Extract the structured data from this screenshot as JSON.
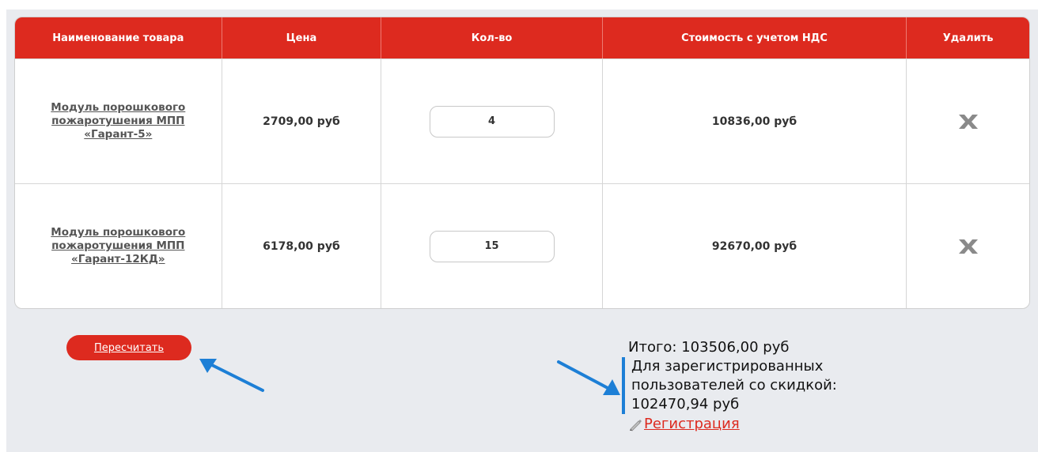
{
  "table": {
    "headers": [
      "Наименование товара",
      "Цена",
      "Кол-во",
      "Стоимость с учетом НДС",
      "Удалить"
    ],
    "rows": [
      {
        "name": "Модуль порошкового пожаротушения МПП «Гарант-5»",
        "price": "2709,00 руб",
        "qty": "4",
        "cost": "10836,00 руб"
      },
      {
        "name": "Модуль порошкового пожаротушения МПП «Гарант-12КД»",
        "price": "6178,00 руб",
        "qty": "15",
        "cost": "92670,00 руб"
      }
    ]
  },
  "actions": {
    "recalc_label": "Пересчитать"
  },
  "totals": {
    "total": "Итого: 103506,00 руб",
    "discount_line1": "Для зарегистрированных",
    "discount_line2": "пользователей со скидкой:",
    "discount_value": "102470,94 руб",
    "register_label": "Регистрация"
  },
  "colors": {
    "accent": "#dd2a1f",
    "arrow": "#1d7fd6",
    "panel": "#e9ebef"
  }
}
